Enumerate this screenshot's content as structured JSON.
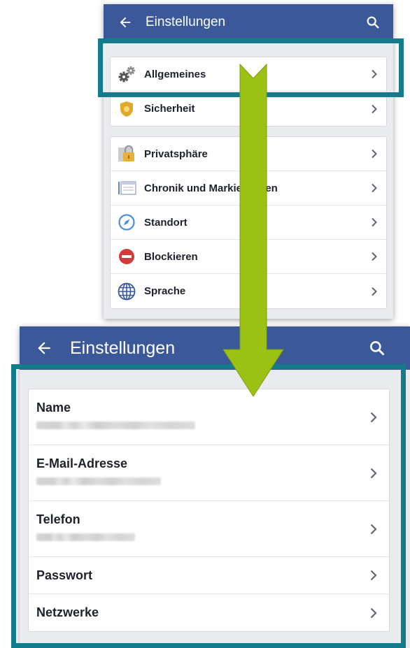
{
  "top_screen": {
    "header": {
      "title": "Einstellungen",
      "back_icon": "arrow-left-icon",
      "search_icon": "search-icon"
    },
    "group1": [
      {
        "label": "Allgemeines",
        "icon": "gears-icon"
      },
      {
        "label": "Sicherheit",
        "icon": "security-badge-icon"
      }
    ],
    "group2": [
      {
        "label": "Privatsphäre",
        "icon": "padlock-icon"
      },
      {
        "label": "Chronik und Markierungen",
        "icon": "timeline-icon"
      },
      {
        "label": "Standort",
        "icon": "compass-icon"
      },
      {
        "label": "Blockieren",
        "icon": "block-icon"
      },
      {
        "label": "Sprache",
        "icon": "globe-icon"
      }
    ]
  },
  "bottom_screen": {
    "header": {
      "title": "Einstellungen",
      "back_icon": "arrow-left-icon",
      "search_icon": "search-icon"
    },
    "items": [
      {
        "label": "Name"
      },
      {
        "label": "E-Mail-Adresse"
      },
      {
        "label": "Telefon"
      },
      {
        "label": "Passwort"
      },
      {
        "label": "Netzwerke"
      }
    ]
  },
  "colors": {
    "header_bg": "#3b5998",
    "highlight": "#137b8a",
    "arrow": "#9bc114",
    "page_bg": "#e9ebee"
  }
}
